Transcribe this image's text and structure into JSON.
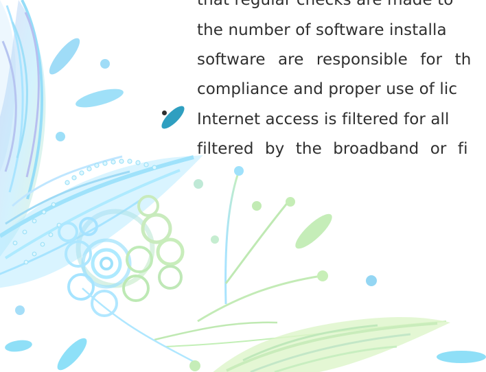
{
  "document": {
    "lines": [
      "that regular checks are made to",
      "the number of software installa",
      "software are responsible for th",
      "compliance and proper use of lic",
      "Internet access is filtered for all",
      "filtered by the broadband or fi"
    ]
  },
  "decor": {
    "palette": {
      "cyan": "#8fdff7",
      "blue": "#8bc8f3",
      "green": "#b9e6b3",
      "lavender": "#b7bff0"
    }
  }
}
